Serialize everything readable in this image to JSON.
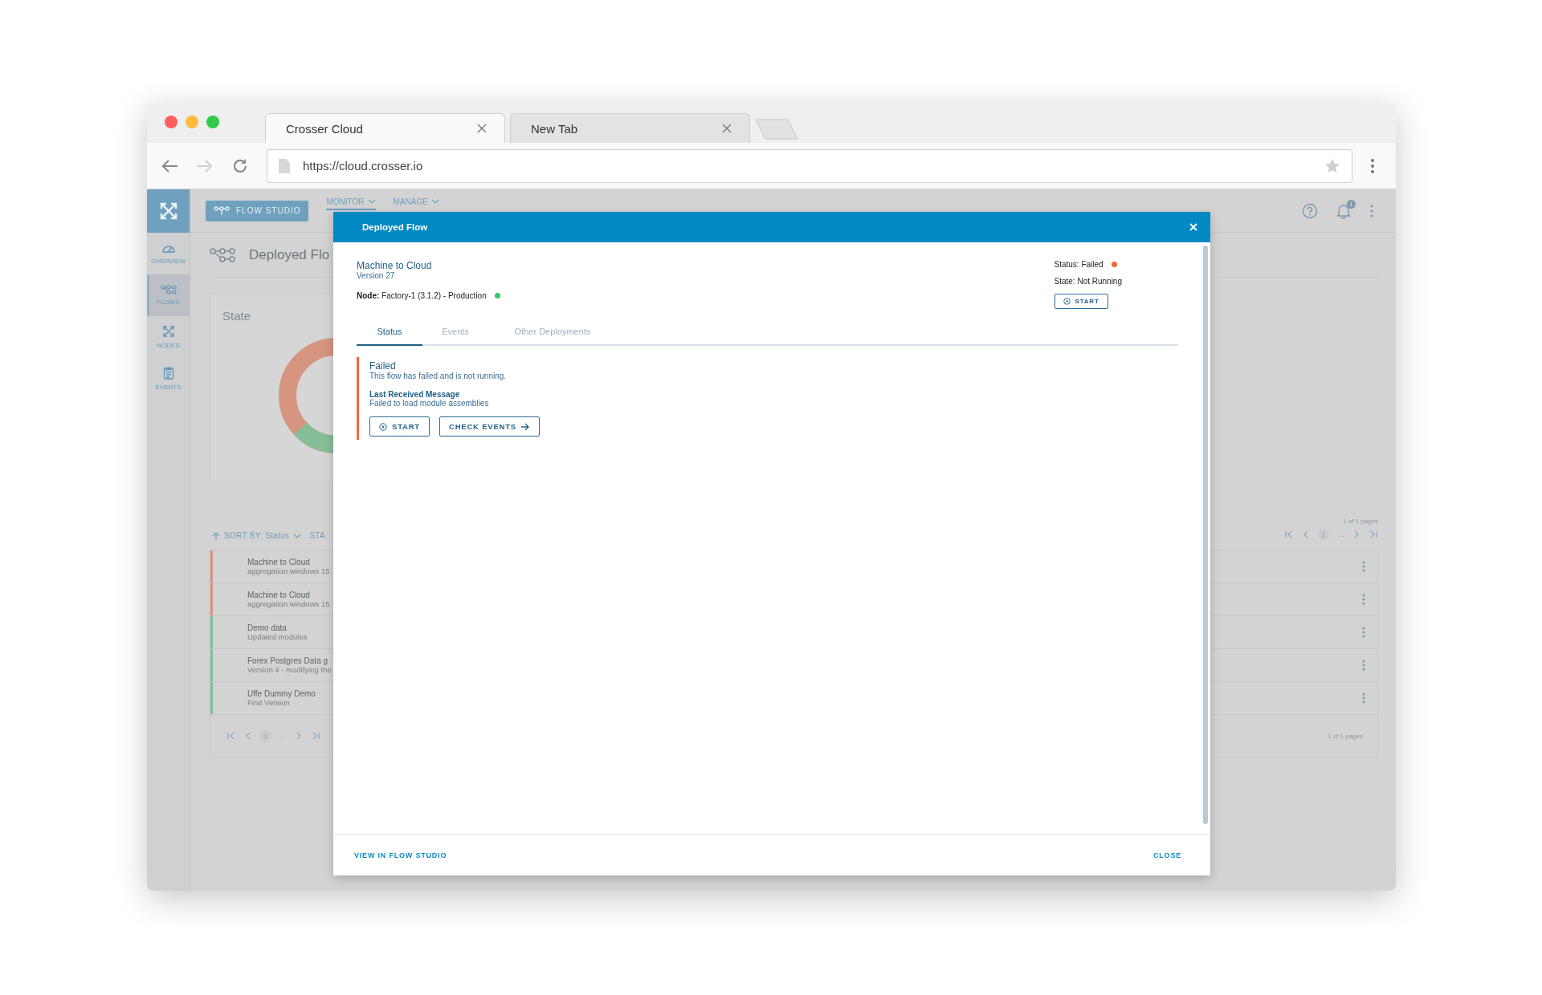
{
  "browser": {
    "tabs": [
      {
        "title": "Crosser Cloud",
        "selected": true
      },
      {
        "title": "New Tab",
        "selected": false
      }
    ],
    "url": "https://cloud.crosser.io"
  },
  "sidebar": {
    "items": [
      {
        "label": "OVERVIEW",
        "kind": "gauge",
        "selected": false
      },
      {
        "label": "FLOWS",
        "kind": "flows",
        "selected": true
      },
      {
        "label": "NODES",
        "kind": "nodes",
        "selected": false
      },
      {
        "label": "EVENTS",
        "kind": "events",
        "selected": false
      }
    ]
  },
  "top_nav": {
    "primary_button": "FLOW STUDIO",
    "menus": [
      {
        "label": "MONITOR",
        "selected": true
      },
      {
        "label": "MANAGE",
        "selected": false
      }
    ],
    "notification_count": "1"
  },
  "page": {
    "title": "Deployed Flo",
    "state_card": {
      "title": "State"
    },
    "sort": {
      "label": "SORT BY: Status",
      "next_label": "STA"
    },
    "pagination_top": {
      "summary": "1 of 1 pages",
      "current_page": "1",
      "ellipsis": "…"
    },
    "flows": [
      {
        "name": "Machine to Cloud",
        "description": "aggregation windows 15",
        "color": "#d9937f"
      },
      {
        "name": "Machine to Cloud",
        "description": "aggregation windows 15",
        "color": "#d9937f"
      },
      {
        "name": "Demo data",
        "description": "Updated modules",
        "color": "#80bf98"
      },
      {
        "name": "Forex Postgres Data g",
        "description": "Version 4 - modifying the",
        "color": "#80bf98"
      },
      {
        "name": "Uffe Dummy Demo",
        "description": "First Version",
        "color": "#80bf98"
      }
    ],
    "pagination_bottom": {
      "summary": "1 of 1 pages",
      "current_page": "1",
      "ellipsis": "…"
    }
  },
  "modal": {
    "title": "Deployed Flow",
    "flow_name": "Machine to Cloud",
    "version": "Version 27",
    "node": {
      "text": "**Node:** Factory-1 (3.1.2) - Production",
      "online": true
    },
    "status": {
      "text": "Status: Failed",
      "kind": "failed"
    },
    "state": "State: Not Running",
    "start_button": "START",
    "tabs": [
      {
        "label": "Status",
        "selected": true
      },
      {
        "label": "Events",
        "selected": false
      },
      {
        "label": "Other Deployments",
        "selected": false
      }
    ],
    "alert": {
      "kind": "error",
      "title": "Failed",
      "message": "This flow has failed and is not running.",
      "last_message_label": "Last Received Message",
      "last_message": "Failed to load module assemblies",
      "start_button": "START",
      "events_button": "CHECK EVENTS"
    },
    "footer": {
      "left_button": "VIEW IN FLOW STUDIO",
      "right_button": "CLOSE"
    }
  }
}
